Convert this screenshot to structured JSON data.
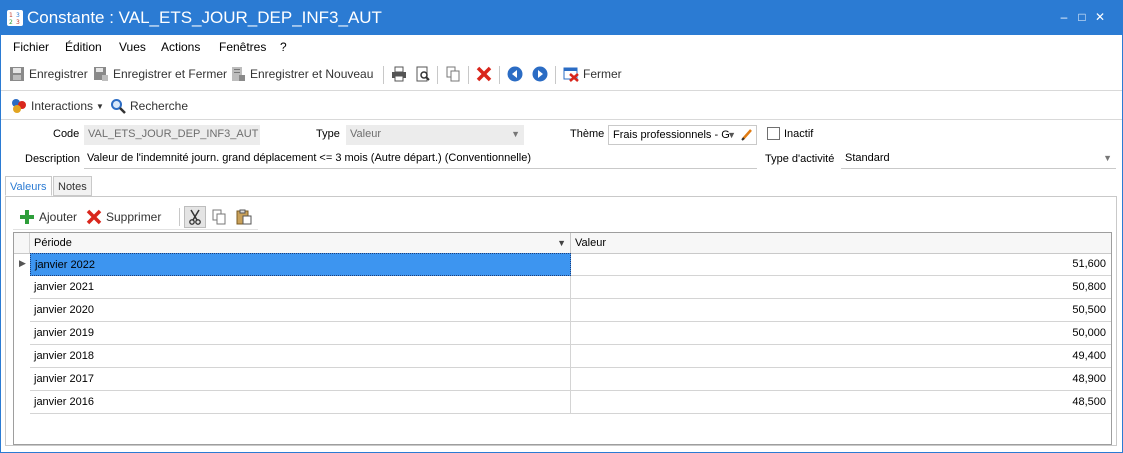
{
  "window": {
    "title": "Constante : VAL_ETS_JOUR_DEP_INF3_AUT",
    "minimize": "‒",
    "maximize": "□",
    "close": "✕",
    "app_icon_text": "1 3\n2 3"
  },
  "menu": [
    "Fichier",
    "Édition",
    "Vues",
    "Actions",
    "Fenêtres",
    "?"
  ],
  "toolbar": {
    "save": "Enregistrer",
    "save_close": "Enregistrer et Fermer",
    "save_new": "Enregistrer et Nouveau",
    "close": "Fermer"
  },
  "toolbar2": {
    "interactions": "Interactions",
    "search": "Recherche"
  },
  "form": {
    "code_label": "Code",
    "code_value": "VAL_ETS_JOUR_DEP_INF3_AUT",
    "type_label": "Type",
    "type_value": "Valeur",
    "theme_label": "Thème",
    "theme_value": "Frais professionnels - G",
    "inactive_label": "Inactif",
    "description_label": "Description",
    "description_value": "Valeur de l'indemnité journ. grand déplacement <= 3 mois (Autre départ.) (Conventionnelle)",
    "activity_label": "Type d'activité",
    "activity_value": "Standard"
  },
  "tabs": [
    "Valeurs",
    "Notes"
  ],
  "grid_toolbar": {
    "add": "Ajouter",
    "delete": "Supprimer"
  },
  "grid": {
    "columns": [
      "Période",
      "Valeur"
    ],
    "rows": [
      {
        "periode": "janvier 2022",
        "valeur": "51,600"
      },
      {
        "periode": "janvier 2021",
        "valeur": "50,800"
      },
      {
        "periode": "janvier 2020",
        "valeur": "50,500"
      },
      {
        "periode": "janvier 2019",
        "valeur": "50,000"
      },
      {
        "periode": "janvier 2018",
        "valeur": "49,400"
      },
      {
        "periode": "janvier 2017",
        "valeur": "48,900"
      },
      {
        "periode": "janvier 2016",
        "valeur": "48,500"
      }
    ]
  },
  "colors": {
    "titlebar": "#2b7bd3",
    "selection": "#3d95f0",
    "delete_red": "#d9261c",
    "add_green": "#2e9e3a"
  }
}
